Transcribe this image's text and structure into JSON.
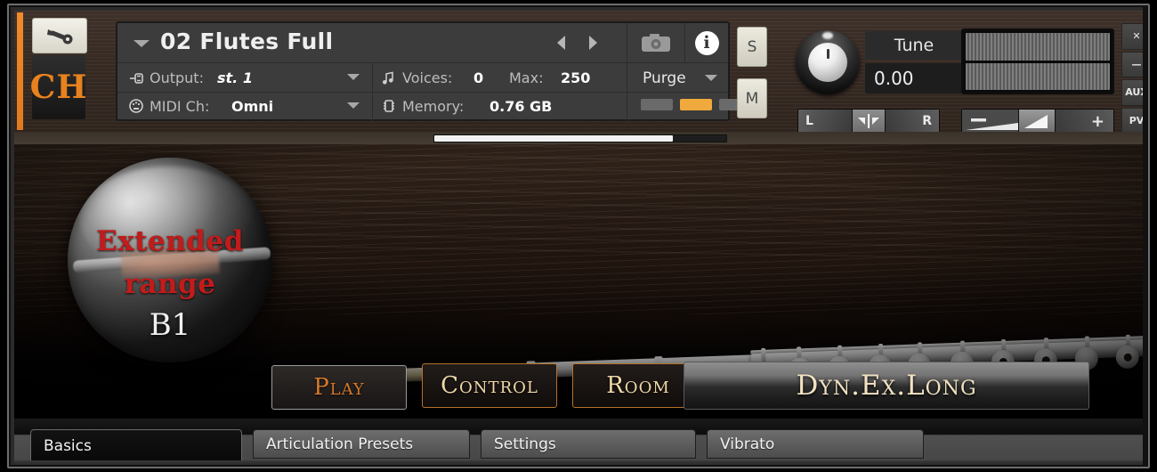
{
  "window": {
    "side_buttons": [
      {
        "name": "close",
        "label": "✕"
      },
      {
        "name": "minimize",
        "label": "—"
      },
      {
        "name": "aux",
        "label": "AUX"
      },
      {
        "name": "pv",
        "label": "PV"
      }
    ]
  },
  "header": {
    "logo_text": "CH",
    "wrench_icon": "wrench-icon",
    "preset_name": "02 Flutes Full",
    "snapshot_icon": "camera-icon",
    "info_icon": "info-icon",
    "output": {
      "label": "Output:",
      "value": "st. 1",
      "icon": "output-icon"
    },
    "midi": {
      "label": "MIDI Ch:",
      "value": "Omni",
      "icon": "midi-icon"
    },
    "voices": {
      "label": "Voices:",
      "value": "0",
      "icon": "voices-icon"
    },
    "max": {
      "label": "Max:",
      "value": "250"
    },
    "memory": {
      "label": "Memory:",
      "value": "0.76 GB",
      "icon": "memory-icon"
    },
    "purge": {
      "label": "Purge"
    },
    "purge_leds": [
      "#6a6a6a",
      "#f0a93c",
      "#6a6a6a"
    ],
    "solo_button": "S",
    "mute_button": "M",
    "tune": {
      "label": "Tune",
      "value": "0.00"
    },
    "pan": {
      "left": "L",
      "right": "R"
    },
    "volume": {
      "minus": "–",
      "plus": "+"
    }
  },
  "panel": {
    "badge": {
      "line1": "Extended",
      "line2": "range",
      "line3": "B1"
    },
    "buttons": [
      {
        "name": "play",
        "label": "Play"
      },
      {
        "name": "control",
        "label": "Control"
      },
      {
        "name": "room",
        "label": "Room"
      },
      {
        "name": "dyn-ex-long",
        "label": "Dyn.Ex.Long"
      }
    ]
  },
  "tabs": [
    {
      "name": "basics",
      "label": "Basics",
      "active": true
    },
    {
      "name": "articulation-presets",
      "label": "Articulation Presets",
      "active": false
    },
    {
      "name": "settings",
      "label": "Settings",
      "active": false
    },
    {
      "name": "vibrato",
      "label": "Vibrato",
      "active": false
    }
  ],
  "colors": {
    "accent_orange": "#f08a2a",
    "badge_red": "#c21b1b",
    "gold_text": "#f0d8a8",
    "led_active": "#f0a93c"
  }
}
